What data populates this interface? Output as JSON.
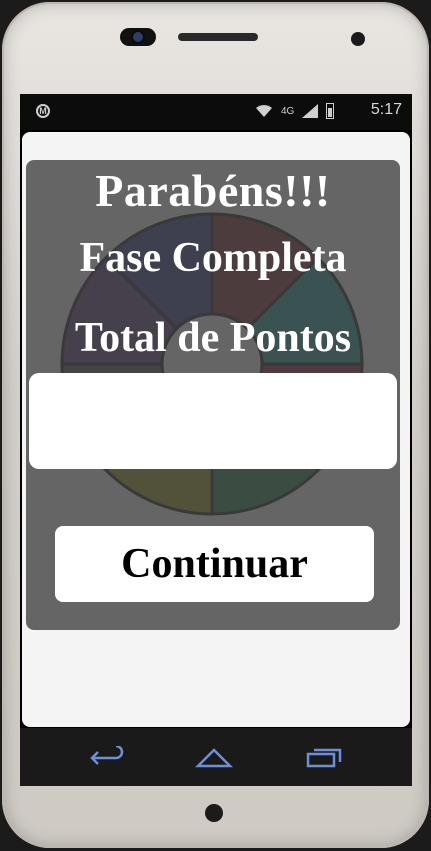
{
  "status_bar": {
    "time": "5:17",
    "network": "4G"
  },
  "dialog": {
    "title": "Parabéns!!!",
    "subtitle": "Fase Completa",
    "points_label": "Total de Pontos",
    "points_value": "",
    "continue_label": "Continuar"
  },
  "wheel": {
    "segments": [
      {
        "color": "#1f2a78"
      },
      {
        "color": "#6e1418"
      },
      {
        "color": "#0e8a8a"
      },
      {
        "color": "#7a0a3c"
      },
      {
        "color": "#0d6b3a"
      },
      {
        "color": "#8a8a10"
      },
      {
        "color": "#3d3d3d"
      },
      {
        "color": "#4a2a6a"
      }
    ]
  },
  "nav": {
    "back_icon": "back-arrow-icon",
    "home_icon": "home-icon",
    "recent_icon": "recent-apps-icon"
  }
}
